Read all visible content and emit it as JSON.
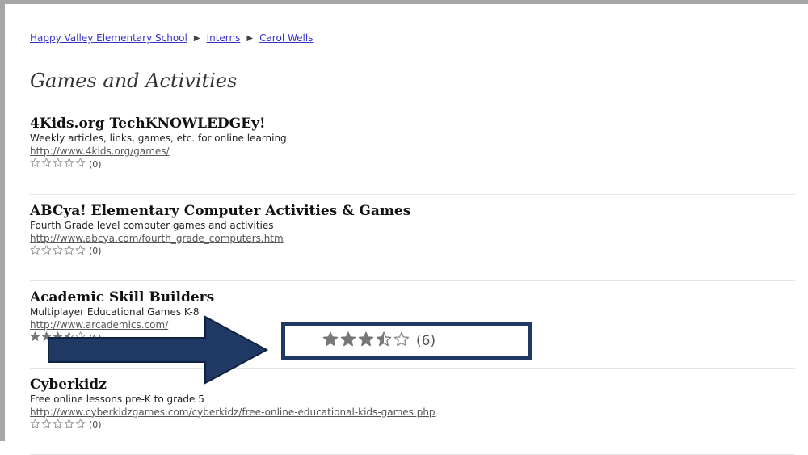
{
  "breadcrumb": {
    "items": [
      "Happy Valley Elementary School",
      "Interns",
      "Carol Wells"
    ],
    "separator_icon": "triangle-right-icon"
  },
  "page_title": "Games and Activities",
  "colors": {
    "link": "#3333cc",
    "callout_border": "#1f3864",
    "arrow_fill": "#1f3864",
    "star_filled": "#777777",
    "star_empty": "#8a8a8a"
  },
  "items": [
    {
      "title": "4Kids.org TechKNOWLEDGEy!",
      "description": "Weekly articles, links, games, etc. for online learning",
      "url": "http://www.4kids.org/games/",
      "rating": 0,
      "rating_count": "(0)"
    },
    {
      "title": "ABCya! Elementary Computer Activities & Games",
      "description": "Fourth Grade level computer games and activities",
      "url": "http://www.abcya.com/fourth_grade_computers.htm",
      "rating": 0,
      "rating_count": "(0)"
    },
    {
      "title": "Academic Skill Builders",
      "description": "Multiplayer Educational Games K-8",
      "url": "http://www.arcademics.com/",
      "rating": 3.5,
      "rating_count": "(6)"
    },
    {
      "title": "Cyberkidz",
      "description": "Free online lessons pre-K to grade 5",
      "url": "http://www.cyberkidzgames.com/cyberkidz/free-online-educational-kids-games.php",
      "rating": 0,
      "rating_count": "(0)"
    }
  ],
  "callout": {
    "rating": 3.5,
    "rating_count": "(6)"
  }
}
